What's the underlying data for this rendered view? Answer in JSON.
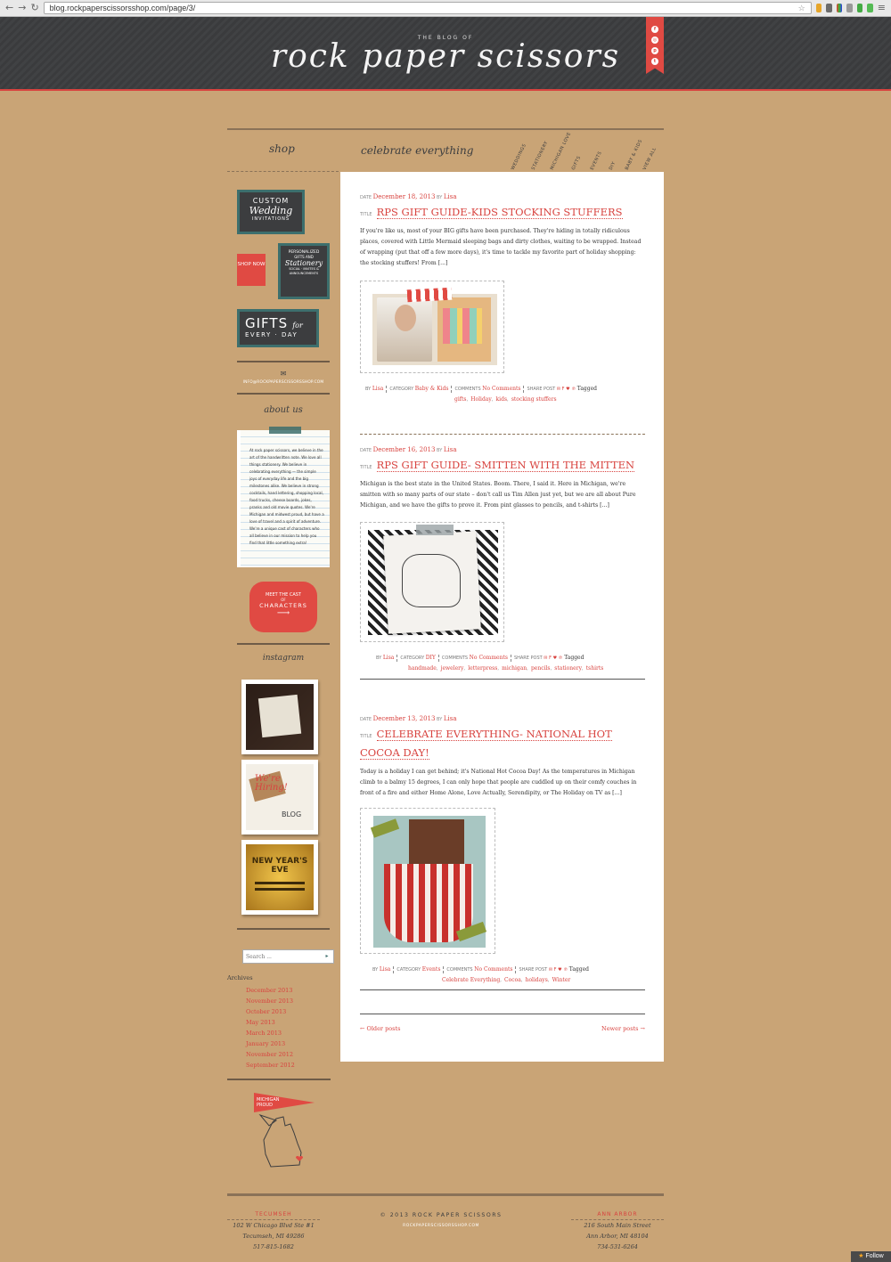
{
  "browser": {
    "url": "blog.rockpaperscissorsshop.com/page/3/",
    "back": "←",
    "forward": "→",
    "reload": "↻"
  },
  "header": {
    "tagline": "THE BLOG OF",
    "logo": "rock paper scissors"
  },
  "nav": {
    "shop_heading": "shop",
    "celebrate_heading": "celebrate everything",
    "categories": [
      "WEDDINGS",
      "STATIONERY",
      "MICHIGAN LOVE",
      "GIFTS",
      "EVENTS",
      "DIY",
      "BABY & KIDS",
      "VIEW ALL"
    ]
  },
  "sidebar": {
    "wedding": {
      "line1": "CUSTOM",
      "line2": "Wedding",
      "line3": "INVITATIONS"
    },
    "shop_now": "SHOP NOW",
    "personalized": {
      "line1": "PERSONALIZED",
      "line2": "GIFTS AND",
      "line3": "Stationery",
      "line4": "SOCIAL · INVITES & ANNOUNCEMENTS"
    },
    "gifts": {
      "line1": "GIFTS",
      "line2": "for",
      "line3": "EVERY · DAY"
    },
    "email": "INFO@ROCKPAPERSCISSORSSHOP.COM",
    "about_heading": "about us",
    "about_text": "At rock paper scissors, we believe in the art of the handwritten note. We love all things stationery. We believe in celebrating everything — the simple joys of everyday life and the big milestones alike. We believe in strong cocktails, hand lettering, shopping local, food trucks, cheese boards, jokes, pranks and old movie quotes. We're Michigan and midwest proud, but have a love of travel and a spirit of adventure. We're a unique cast of characters who all believe in our mission to help you find that little something extra!",
    "cast": {
      "line1": "MEET THE CAST",
      "line2": "OF",
      "line3": "CHARACTERS"
    },
    "instagram_heading": "instagram",
    "insta2": {
      "line1": "We're",
      "line2": "Hiring!",
      "line3": "BLOG"
    },
    "insta3": {
      "line1": "NEW YEAR'S EVE"
    },
    "search_placeholder": "Search ...",
    "archives_heading": "Archives",
    "archives": [
      "December 2013",
      "November 2013",
      "October 2013",
      "May 2013",
      "March 2013",
      "January 2013",
      "November 2012",
      "September 2012"
    ],
    "michigan": "MICHIGAN PROUD"
  },
  "labels": {
    "date": "DATE",
    "by": "BY",
    "title": "TITLE",
    "category": "CATEGORY",
    "comments": "COMMENTS",
    "share": "SHARE POST",
    "tagged": "Tagged"
  },
  "posts": [
    {
      "date": "December 18, 2013",
      "author": "Lisa",
      "title": "RPS GIFT GUIDE-KIDS STOCKING STUFFERS",
      "excerpt": "If you're like us, most of your BIG gifts have been purchased. They're hiding in totally ridiculous places, covered with Little Mermaid sleeping bags and dirty clothes, waiting to be wrapped. Instead of wrapping (put that off a few more days), it's time to tackle my favorite part of holiday shopping: the stocking stuffers! From [...]",
      "category": "Baby & Kids",
      "comments": "No Comments",
      "tags": [
        "gifts",
        "Holiday",
        "kids",
        "stocking stuffers"
      ]
    },
    {
      "date": "December 16, 2013",
      "author": "Lisa",
      "title": "RPS GIFT GUIDE- SMITTEN WITH THE MITTEN",
      "excerpt": "Michigan is the best state in the United States. Boom. There, I said it. Here in Michigan, we're smitten with so many parts of our state – don't call us Tim Allen just yet, but we are all about Pure Michigan, and we have the gifts to prove it. From pint glasses to pencils, and t-shirts [...]",
      "category": "DIY",
      "comments": "No Comments",
      "tags": [
        "handmade",
        "jewelery",
        "letterpress",
        "michigan",
        "pencils",
        "stationery",
        "tshirts"
      ]
    },
    {
      "date": "December 13, 2013",
      "author": "Lisa",
      "title": "CELEBRATE EVERYTHING- NATIONAL HOT COCOA DAY!",
      "excerpt": "Today is a holiday I can get behind; it's National Hot Cocoa Day! As the temperatures in Michigan climb to a balmy 15 degrees, I can only hope that people are cuddled up on their comfy couches in front of a fire and either Home Alone, Love Actually, Serendipity, or The Holiday on TV as [...]",
      "category": "Events",
      "comments": "No Comments",
      "tags": [
        "Celebrate Everything",
        "Cocoa",
        "holidays",
        "Winter"
      ]
    }
  ],
  "pagination": {
    "older": "← Older posts",
    "newer": "Newer posts →"
  },
  "footer": {
    "left": {
      "city": "TECUMSEH",
      "line1": "102 W Chicago Blvd Ste #1",
      "line2": "Tecumseh, MI 49286",
      "line3": "517-815-1682"
    },
    "center": {
      "copyright": "© 2013 ROCK PAPER SCISSORS",
      "url": "ROCKPAPERSCISSORSSHOP.COM"
    },
    "right": {
      "city": "ANN ARBOR",
      "line1": "216 South Main Street",
      "line2": "Ann Arbor, MI 48104",
      "line3": "734-531-6264"
    },
    "follow": "Follow"
  },
  "colors": {
    "accent": "#d8433f",
    "kraft": "#c9a476",
    "chalkboard": "#3c3d3f",
    "teal": "#3d6f6d"
  }
}
